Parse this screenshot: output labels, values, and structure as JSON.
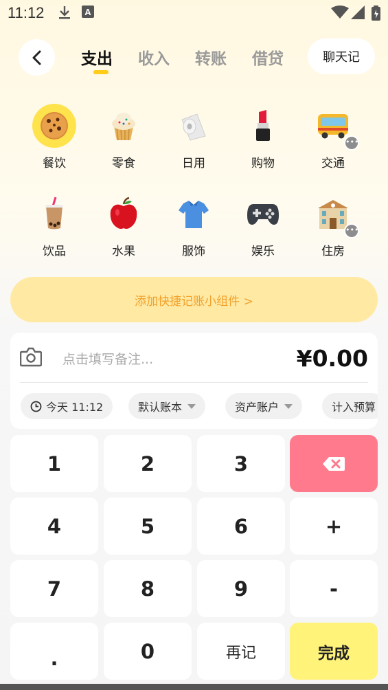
{
  "status_bar": {
    "time": "11:12"
  },
  "tabs": [
    {
      "label": "支出",
      "active": true
    },
    {
      "label": "收入",
      "active": false
    },
    {
      "label": "转账",
      "active": false
    },
    {
      "label": "借贷",
      "active": false
    }
  ],
  "chat_button": "聊天记",
  "categories": [
    {
      "label": "餐饮",
      "icon": "cookie-icon",
      "selected": true
    },
    {
      "label": "零食",
      "icon": "cupcake-icon"
    },
    {
      "label": "日用",
      "icon": "toilet-paper-icon"
    },
    {
      "label": "购物",
      "icon": "lipstick-icon"
    },
    {
      "label": "交通",
      "icon": "bus-icon",
      "has_more": true
    },
    {
      "label": "饮品",
      "icon": "bubble-tea-icon"
    },
    {
      "label": "水果",
      "icon": "apple-icon"
    },
    {
      "label": "服饰",
      "icon": "shirt-icon"
    },
    {
      "label": "娱乐",
      "icon": "gamepad-icon"
    },
    {
      "label": "住房",
      "icon": "building-icon",
      "has_more": true
    }
  ],
  "banner": "添加快捷记账小组件 >",
  "entry": {
    "note_placeholder": "点击填写备注...",
    "amount": "¥0.00",
    "chips": [
      {
        "label": "今天 11:12",
        "icon": "clock-icon"
      },
      {
        "label": "默认账本",
        "dropdown": true
      },
      {
        "label": "资产账户",
        "dropdown": true
      },
      {
        "label": "计入预算"
      }
    ]
  },
  "keypad": {
    "keys": [
      "1",
      "2",
      "3",
      "",
      "4",
      "5",
      "6",
      "+",
      "7",
      "8",
      "9",
      "-",
      ".",
      "0",
      "再记",
      "完成"
    ],
    "delete_icon": "backspace-icon"
  },
  "colors": {
    "accent_yellow": "#ffcc1a",
    "delete_red": "#ff7a8c",
    "done_yellow": "#fff37a",
    "banner_bg": "#ffe9a3",
    "banner_text": "#f2a12c"
  }
}
